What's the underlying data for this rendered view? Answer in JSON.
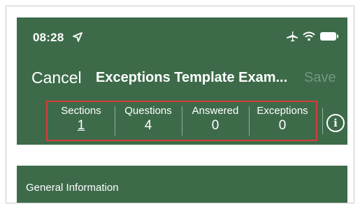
{
  "status_bar": {
    "time": "08:28",
    "icons": [
      "location-arrow-icon",
      "airplane-icon",
      "wifi-icon",
      "battery-icon"
    ]
  },
  "nav": {
    "cancel_label": "Cancel",
    "title": "Exceptions Template Exam...",
    "save_label": "Save"
  },
  "counters": [
    {
      "label": "Sections",
      "value": "1"
    },
    {
      "label": "Questions",
      "value": "4"
    },
    {
      "label": "Answered",
      "value": "0"
    },
    {
      "label": "Exceptions",
      "value": "0"
    }
  ],
  "info_button": {
    "icon": "info-icon",
    "glyph": "i"
  },
  "section": {
    "title": "General Information"
  },
  "colors": {
    "header_bg": "#3d6b4a",
    "highlight_border": "#d93b3b",
    "disabled_text": "#6f9a7b"
  }
}
